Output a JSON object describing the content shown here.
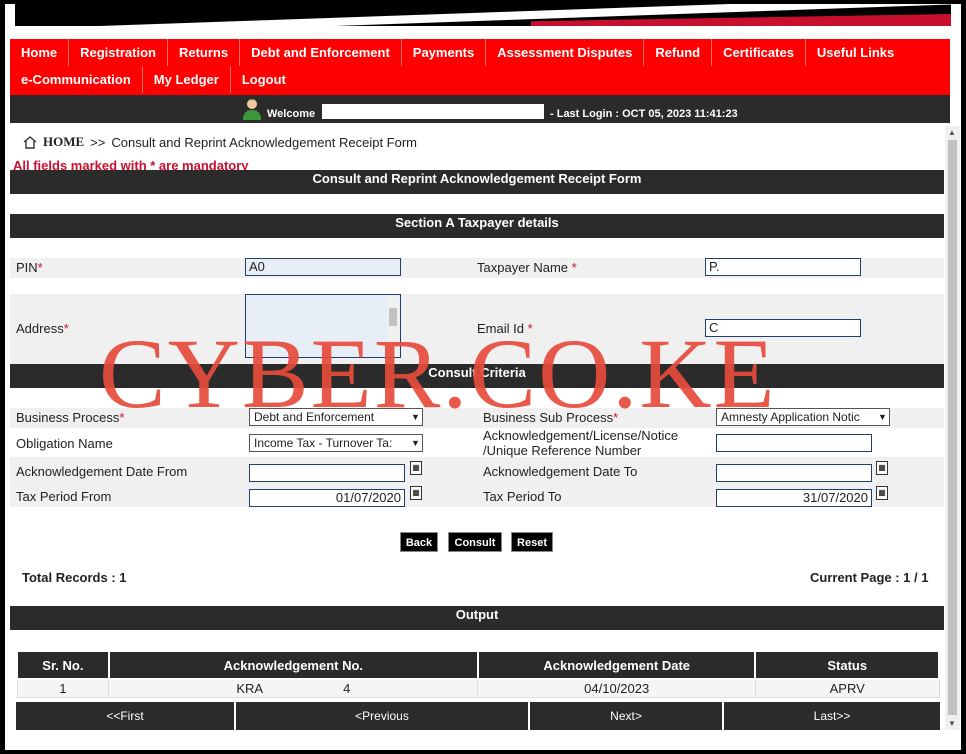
{
  "nav": {
    "row1": [
      "Home",
      "Registration",
      "Returns",
      "Debt and Enforcement",
      "Payments",
      "Assessment Disputes",
      "Refund",
      "Certificates",
      "Useful Links"
    ],
    "row2": [
      "e-Communication",
      "My Ledger",
      "Logout"
    ]
  },
  "welcome": {
    "greeting": "Welcome",
    "last_login": "- Last Login : OCT 05, 2023 11:41:23"
  },
  "breadcrumb": {
    "home": "HOME",
    "sep": ">>",
    "current": "Consult and Reprint Acknowledgement Receipt Form"
  },
  "mandatory_note": "All fields marked with * are mandatory",
  "form_title": "Consult and Reprint Acknowledgement Receipt Form",
  "section_a": {
    "title": "Section A Taxpayer details",
    "pin_label": "PIN",
    "pin_value": "A0",
    "taxpayer_name_label": "Taxpayer Name",
    "taxpayer_name_value": "P.",
    "address_label": "Address",
    "email_label": "Email Id",
    "email_value": "C"
  },
  "criteria": {
    "title": "Consult Criteria",
    "business_process_label": "Business Process",
    "business_process_value": "Debt and Enforcement",
    "business_sub_process_label": "Business Sub Process",
    "business_sub_process_value": "Amnesty Application Notic",
    "obligation_label": "Obligation Name",
    "obligation_value": "Income Tax - Turnover Ta:",
    "ack_ref_label_1": "Acknowledgement/License/Notice",
    "ack_ref_label_2": "/Unique Reference Number",
    "ack_date_from_label": "Acknowledgement Date From",
    "ack_date_to_label": "Acknowledgement Date To",
    "tax_period_from_label": "Tax Period From",
    "tax_period_from_value": "01/07/2020",
    "tax_period_to_label": "Tax Period To",
    "tax_period_to_value": "31/07/2020"
  },
  "buttons": {
    "back": "Back",
    "consult": "Consult",
    "reset": "Reset"
  },
  "summary": {
    "total_records": "Total Records : 1",
    "current_page": "Current Page : 1 / 1"
  },
  "output": {
    "title": "Output",
    "columns": [
      "Sr. No.",
      "Acknowledgement No.",
      "Acknowledgement Date",
      "Status"
    ],
    "rows": [
      [
        "1",
        "KRA",
        "04/10/2023",
        "APRV"
      ]
    ],
    "ack_suffix": "4"
  },
  "pager": [
    "<<First",
    "<Previous",
    "Next>",
    "Last>>"
  ],
  "watermark": "CYBER.CO.KE"
}
